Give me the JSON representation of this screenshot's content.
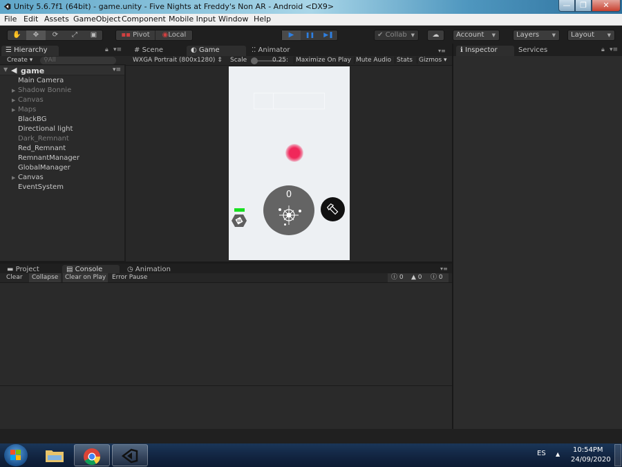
{
  "window": {
    "title": "Unity 5.6.7f1 (64bit) - game.unity - Five Nights at Freddy's Non AR - Android <DX9>",
    "controls": {
      "minimize": "—",
      "maximize": "❐",
      "close": "✕"
    }
  },
  "menubar": {
    "items": [
      "File",
      "Edit",
      "Assets",
      "GameObject",
      "Component",
      "Mobile Input",
      "Window",
      "Help"
    ]
  },
  "toolbar": {
    "transform_tools": [
      {
        "name": "hand-tool",
        "icon": "✋"
      },
      {
        "name": "move-tool",
        "icon": "✥"
      },
      {
        "name": "rotate-tool",
        "icon": "⟳"
      },
      {
        "name": "scale-tool",
        "icon": "⤢"
      },
      {
        "name": "rect-tool",
        "icon": "▣"
      }
    ],
    "active_tool": "move-tool",
    "pivot_label": "Pivot",
    "local_label": "Local",
    "play": {
      "play": "▶",
      "pause": "❚❚",
      "step": "▶❚",
      "playing": true,
      "accent": "#2e7fe0"
    },
    "collab_label": "Collab",
    "cloud_icon": "☁",
    "account_label": "Account",
    "layers_label": "Layers",
    "layout_label": "Layout"
  },
  "hierarchy": {
    "tab_label": "Hierarchy",
    "create_label": "Create",
    "search_placeholder": "All",
    "scene_name": "game",
    "items": [
      {
        "label": "Main Camera",
        "expandable": false,
        "active": true
      },
      {
        "label": "Shadow Bonnie",
        "expandable": true,
        "active": false
      },
      {
        "label": "Canvas",
        "expandable": true,
        "active": false
      },
      {
        "label": "Maps",
        "expandable": true,
        "active": false
      },
      {
        "label": "BlackBG",
        "expandable": false,
        "active": true
      },
      {
        "label": "Directional light",
        "expandable": false,
        "active": true
      },
      {
        "label": "Dark_Remnant",
        "expandable": false,
        "active": false
      },
      {
        "label": "Red_Remnant",
        "expandable": false,
        "active": true
      },
      {
        "label": "RemnantManager",
        "expandable": false,
        "active": true
      },
      {
        "label": "GlobalManager",
        "expandable": false,
        "active": true
      },
      {
        "label": "Canvas",
        "expandable": true,
        "active": true
      },
      {
        "label": "EventSystem",
        "expandable": false,
        "active": true
      }
    ]
  },
  "center": {
    "tabs": [
      {
        "label": "Scene",
        "icon": "#",
        "active": false
      },
      {
        "label": "Game",
        "icon": "◐",
        "active": true
      },
      {
        "label": "Animator",
        "icon": "⁚⁚",
        "active": false
      }
    ],
    "game_bar": {
      "resolution": "WXGA Portrait (800x1280)",
      "scale_label": "Scale",
      "scale_value": "0.25:",
      "maximize_on_play": "Maximize On Play",
      "mute_audio": "Mute Audio",
      "stats": "Stats",
      "gizmos": "Gizmos"
    },
    "game": {
      "score": "0",
      "health_color": "#18e020",
      "blob_color": "#f0285a",
      "battery_fraction": 1.0
    }
  },
  "bottom": {
    "tabs": [
      {
        "label": "Project",
        "icon": "▬",
        "active": false
      },
      {
        "label": "Console",
        "icon": "▤",
        "active": true
      },
      {
        "label": "Animation",
        "icon": "◷",
        "active": false
      }
    ],
    "console_bar": {
      "clear": "Clear",
      "collapse": "Collapse",
      "clear_on_play": "Clear on Play",
      "error_pause": "Error Pause",
      "info_count": "0",
      "warning_count": "0",
      "error_count": "0"
    }
  },
  "inspector": {
    "tabs": [
      {
        "label": "Inspector",
        "icon": "ℹ",
        "active": true
      },
      {
        "label": "Services",
        "active": false
      }
    ]
  },
  "taskbar": {
    "language": "ES",
    "time": "10:54PM",
    "date": "24/09/2020",
    "apps": [
      "start",
      "file-explorer",
      "chrome",
      "unity"
    ]
  }
}
